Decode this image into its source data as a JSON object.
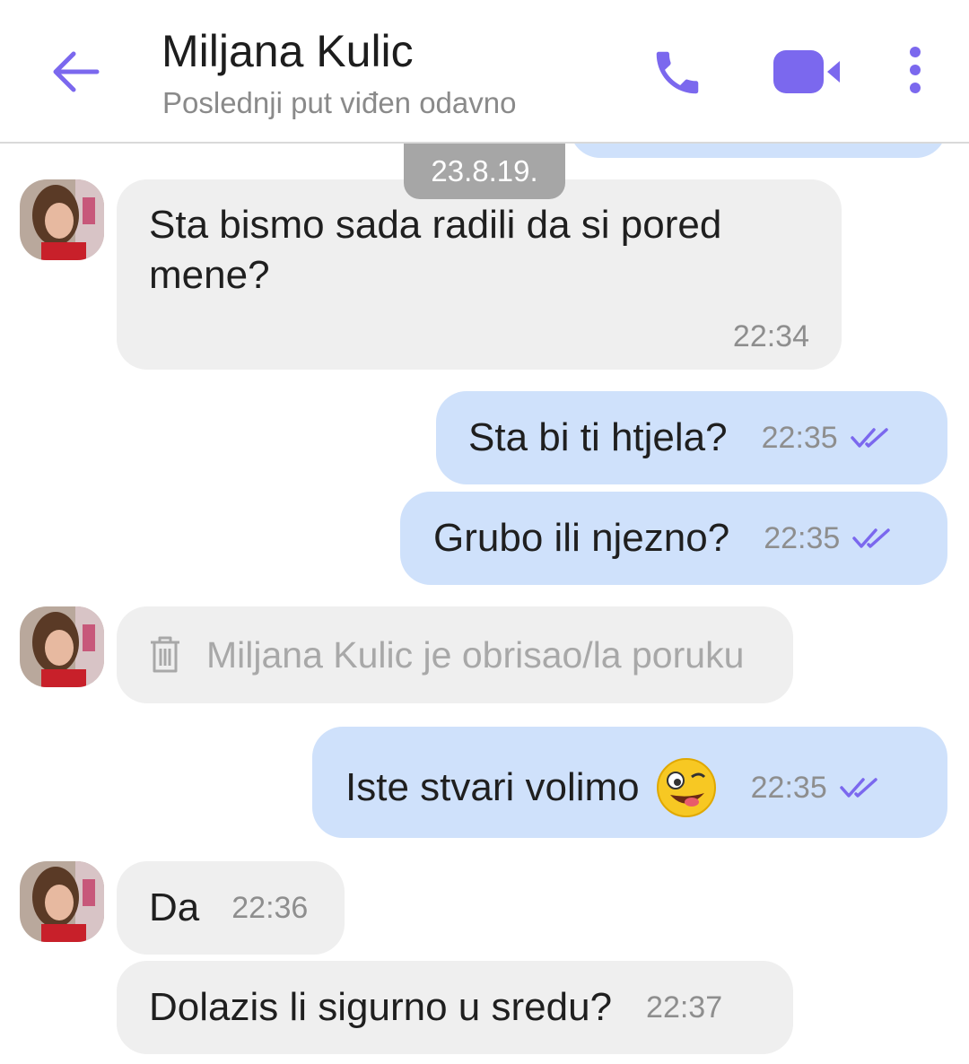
{
  "header": {
    "contact_name": "Miljana Kulic",
    "status": "Poslednji put viđen odavno",
    "icons": [
      "back-arrow-icon",
      "phone-icon",
      "video-camera-icon",
      "more-vert-icon"
    ],
    "accent": "#7b68ee"
  },
  "chat": {
    "date_separator": "23.8.19.",
    "messages": [
      {
        "text": "Sta bismo sada radili da si pored mene?",
        "line1": "Sta bismo sada radili da si pored",
        "line2": "mene?",
        "time": "22:34"
      },
      {
        "text": "Sta bi ti htjela?",
        "time": "22:35"
      },
      {
        "text": "Grubo ili njezno?",
        "time": "22:35"
      },
      {
        "text": "Miljana Kulic je obrisao/la poruku"
      },
      {
        "text": "Iste stvari volimo",
        "emoji": "🤪",
        "time": "22:35"
      },
      {
        "text": "Da",
        "time": "22:36"
      },
      {
        "text": "Dolazis li sigurno u sredu?",
        "time": "22:37"
      }
    ]
  },
  "colors": {
    "incoming_bubble": "#efefef",
    "outgoing_bubble": "#cfe1fb",
    "ticks": "#7b68ee"
  }
}
